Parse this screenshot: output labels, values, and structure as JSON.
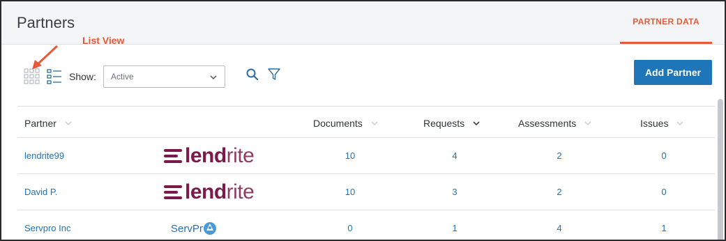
{
  "header": {
    "title": "Partners",
    "tab_label": "PARTNER DATA"
  },
  "annotation": {
    "label": "List View"
  },
  "toolbar": {
    "show_label": "Show:",
    "filter_value": "Active",
    "add_button_label": "Add Partner",
    "icons": [
      "grid-view-icon",
      "list-view-icon",
      "chevron-down-icon",
      "search-icon",
      "filter-icon"
    ]
  },
  "table": {
    "columns": [
      "Partner",
      "Documents",
      "Requests",
      "Assessments",
      "Issues"
    ],
    "rows": [
      {
        "partner": "lendrite99",
        "logo": "lendrite",
        "documents": "10",
        "requests": "4",
        "assessments": "2",
        "issues": "0"
      },
      {
        "partner": "David P.",
        "logo": "lendrite",
        "documents": "10",
        "requests": "3",
        "assessments": "2",
        "issues": "0"
      },
      {
        "partner": "Servpro Inc",
        "logo": "servpro",
        "documents": "0",
        "requests": "1",
        "assessments": "4",
        "issues": "1"
      }
    ]
  },
  "logos": {
    "lendrite_bold": "lend",
    "lendrite_light": "rite",
    "servpro_text": "ServPr"
  },
  "colors": {
    "accent": "#e8583a",
    "primary": "#1e76b8",
    "link": "#1f73b7",
    "lendrite_brand": "#7b1a4a"
  }
}
